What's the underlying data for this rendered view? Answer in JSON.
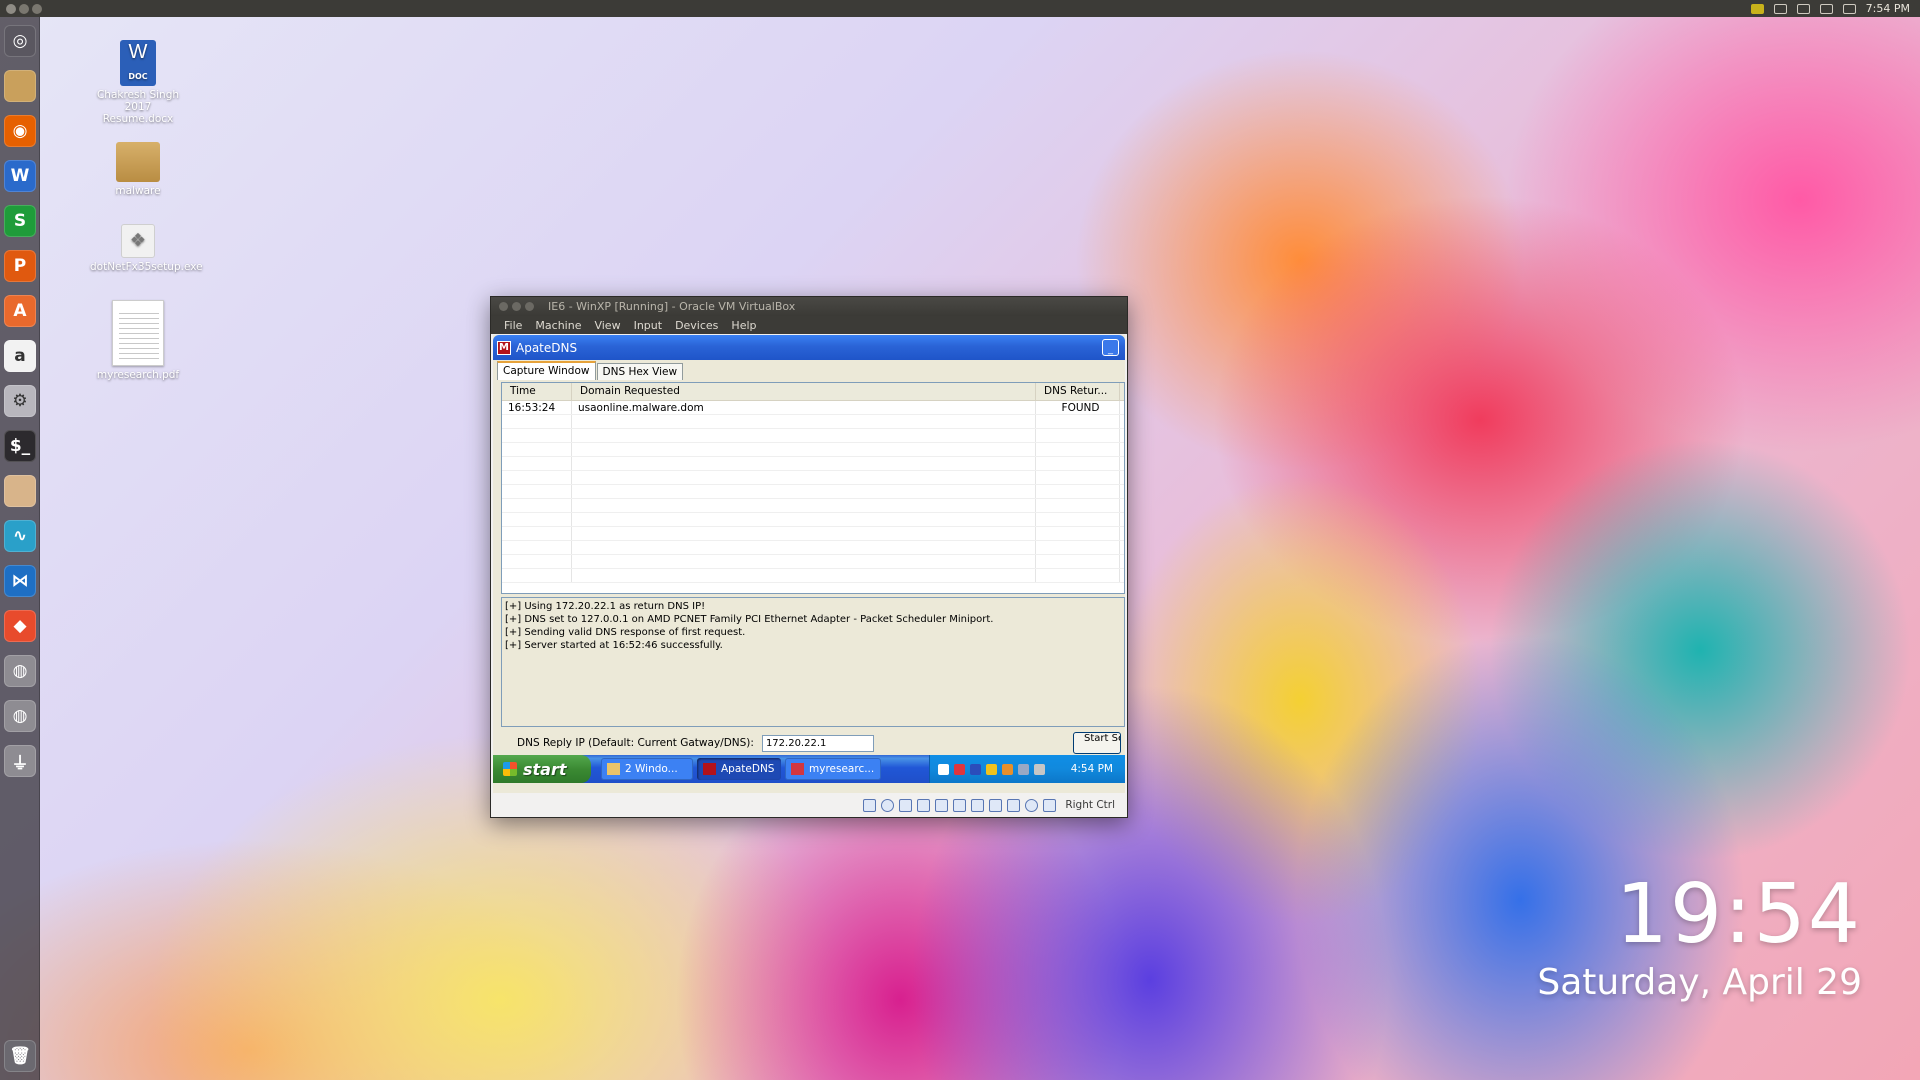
{
  "topbar": {
    "clock": "7:54 PM"
  },
  "desktop_icons": [
    {
      "label": "Chakresh Singh 2017 Resume.docx",
      "badge": "DOC",
      "glyph": "W"
    },
    {
      "label": "malware"
    },
    {
      "label": "dotNetFx35setup.exe"
    },
    {
      "label": "myresearch.pdf"
    }
  ],
  "launcher_items": [
    {
      "name": "dash-icon",
      "glyph": "◎",
      "color": "#5a5760"
    },
    {
      "name": "files-icon",
      "glyph": "",
      "color": "#c9a05c"
    },
    {
      "name": "firefox-icon",
      "glyph": "◉",
      "color": "#e66000"
    },
    {
      "name": "libreoffice-writer-icon",
      "glyph": "W",
      "color": "#2a6acb"
    },
    {
      "name": "libreoffice-calc-icon",
      "glyph": "S",
      "color": "#1f9c3a"
    },
    {
      "name": "libreoffice-impress-icon",
      "glyph": "P",
      "color": "#e0590f"
    },
    {
      "name": "software-center-icon",
      "glyph": "A",
      "color": "#e9692c"
    },
    {
      "name": "amazon-icon",
      "glyph": "a",
      "color": "#f2f2f2"
    },
    {
      "name": "system-settings-icon",
      "glyph": "⚙",
      "color": "#b8b6bd"
    },
    {
      "name": "terminal-icon",
      "glyph": "$_",
      "color": "#2c2a2e"
    },
    {
      "name": "folder-icon",
      "glyph": "",
      "color": "#d8b48a"
    },
    {
      "name": "system-monitor-icon",
      "glyph": "∿",
      "color": "#2aa0c9"
    },
    {
      "name": "vscode-icon",
      "glyph": "⋈",
      "color": "#1e6fc4"
    },
    {
      "name": "git-icon",
      "glyph": "◆",
      "color": "#e84b2c"
    },
    {
      "name": "disk-icon",
      "glyph": "◍",
      "color": "#8e8c92"
    },
    {
      "name": "disk-icon-2",
      "glyph": "◍",
      "color": "#8e8c92"
    },
    {
      "name": "usb-icon",
      "glyph": "⏚",
      "color": "#8e8c92"
    },
    {
      "name": "trash-icon",
      "glyph": "🗑",
      "color": "#6b6970"
    }
  ],
  "vbox": {
    "title": "IE6 - WinXP [Running] - Oracle VM VirtualBox",
    "menu": [
      "File",
      "Machine",
      "View",
      "Input",
      "Devices",
      "Help"
    ],
    "host_key": "Right Ctrl"
  },
  "apatedns": {
    "title": "ApateDNS",
    "app_glyph": "M",
    "min_glyph": "_",
    "tabs": [
      "Capture Window",
      "DNS Hex View"
    ],
    "columns": [
      "Time",
      "Domain Requested",
      "DNS Retur..."
    ],
    "rows": [
      {
        "time": "16:53:24",
        "domain": "usaonline.malware.dom",
        "result": "FOUND"
      }
    ],
    "log": [
      "[+] Using 172.20.22.1 as return DNS IP!",
      "[+] DNS set to 127.0.0.1 on AMD PCNET Family PCI Ethernet Adapter - Packet Scheduler Miniport.",
      "[+] Sending valid DNS response of first request.",
      "[+] Server started at 16:52:46 successfully."
    ],
    "reply_label": "DNS Reply IP (Default: Current Gatway/DNS):",
    "reply_value": "172.20.22.1",
    "start_button": "Start Se"
  },
  "xp_taskbar": {
    "start": "start",
    "tasks": [
      "2 Windo...",
      "ApateDNS",
      "myresearc..."
    ],
    "clock": "4:54 PM"
  },
  "clock_widget": {
    "time": "19:54",
    "date": "Saturday, April 29"
  }
}
